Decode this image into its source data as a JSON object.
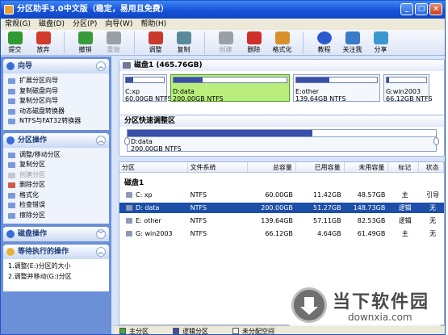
{
  "window": {
    "title": "分区助手3.0中文版（稳定，易用且免费）",
    "minimize": "_",
    "maximize": "□",
    "close": "×"
  },
  "menu": [
    "常规(G)",
    "磁盘(D)",
    "分区(P)",
    "向导(W)",
    "帮助(H)"
  ],
  "toolbar": {
    "items": [
      {
        "label": "提交",
        "icon": "commit-check-icon",
        "color": "#2f9a2f",
        "enabled": true
      },
      {
        "label": "放弃",
        "icon": "discard-x-icon",
        "color": "#d23a2a",
        "enabled": true
      },
      {
        "label": "撤销",
        "icon": "undo-icon",
        "color": "#3a9a3a",
        "enabled": true
      },
      {
        "label": "重做",
        "icon": "redo-icon",
        "color": "#9aa0a8",
        "enabled": false
      },
      {
        "label": "调整",
        "icon": "resize-icon",
        "color": "#c83a2a",
        "enabled": true
      },
      {
        "label": "复制",
        "icon": "copy-icon",
        "color": "#5a8a9a",
        "enabled": true
      },
      {
        "label": "创建",
        "icon": "create-icon",
        "color": "#9aa0a8",
        "enabled": false
      },
      {
        "label": "删除",
        "icon": "delete-icon",
        "color": "#d0302a",
        "enabled": true
      },
      {
        "label": "格式化",
        "icon": "format-icon",
        "color": "#d8902a",
        "enabled": true
      },
      {
        "label": "教程",
        "icon": "help-icon",
        "color": "#2a5ad0",
        "enabled": true
      },
      {
        "label": "关注我",
        "icon": "follow-icon",
        "color": "#3a7ac8",
        "enabled": true
      },
      {
        "label": "分享",
        "icon": "share-icon",
        "color": "#3a9ad0",
        "enabled": true
      }
    ]
  },
  "sidebar": {
    "wizard": {
      "title": "向导",
      "items": [
        "扩展分区向导",
        "复制磁盘向导",
        "复制分区向导",
        "动态磁盘转换器",
        "NTFS与FAT32转换器"
      ]
    },
    "partition_ops": {
      "title": "分区操作",
      "items": [
        {
          "label": "调整/移动分区",
          "enabled": true
        },
        {
          "label": "复制分区",
          "enabled": true
        },
        {
          "label": "创建分区",
          "enabled": false
        },
        {
          "label": "删除分区",
          "enabled": true
        },
        {
          "label": "格式化",
          "enabled": true
        },
        {
          "label": "检查错误",
          "enabled": true
        },
        {
          "label": "擦除分区",
          "enabled": true
        }
      ]
    },
    "disk_ops": {
      "title": "磁盘操作"
    },
    "pending": {
      "title": "等待执行的操作",
      "items": [
        "1.调整(E:)分区的大小",
        "2.调整并移动(G:)分区"
      ]
    }
  },
  "disk": {
    "header": "磁盘1 (465.76GB)",
    "partitions": [
      {
        "name": "C:xp",
        "size": "60.00GB NTFS",
        "used_pct": 0.19,
        "selected": false
      },
      {
        "name": "D:data",
        "size": "200.00GB NTFS",
        "used_pct": 0.26,
        "selected": true
      },
      {
        "name": "E:other",
        "size": "139.64GB NTFS",
        "used_pct": 0.41,
        "selected": false
      },
      {
        "name": "G:win2003",
        "size": "66.12GB NTFS",
        "used_pct": 0.07,
        "selected": false
      }
    ]
  },
  "adjust": {
    "title": "分区快速调整区",
    "name": "D:data",
    "size": "200.00GB NTFS",
    "used_pct": 0.6
  },
  "table": {
    "headers": [
      "分区",
      "文件系统",
      "总容量",
      "已用容量",
      "未用容量",
      "标记",
      "状态"
    ],
    "group": "磁盘1",
    "rows": [
      {
        "name": "C: xp",
        "fs": "NTFS",
        "total": "60.00GB",
        "used": "11.42GB",
        "free": "48.57GB",
        "flag": "主",
        "status": "引导",
        "selected": false
      },
      {
        "name": "D: data",
        "fs": "NTFS",
        "total": "200.00GB",
        "used": "51.27GB",
        "free": "148.73GB",
        "flag": "逻辑",
        "status": "无",
        "selected": true
      },
      {
        "name": "E: other",
        "fs": "NTFS",
        "total": "139.64GB",
        "used": "57.11GB",
        "free": "82.53GB",
        "flag": "逻辑",
        "status": "无",
        "selected": false
      },
      {
        "name": "G: win2003",
        "fs": "NTFS",
        "total": "66.12GB",
        "used": "4.64GB",
        "free": "61.49GB",
        "flag": "主",
        "status": "无",
        "selected": false
      }
    ]
  },
  "legend": [
    {
      "label": "主分区",
      "color": "#3fae3f"
    },
    {
      "label": "逻辑分区",
      "color": "#3a4fa8"
    },
    {
      "label": "未分配空间",
      "color": "#f4f4f4"
    }
  ],
  "watermark": {
    "cn": "当下软件园",
    "en": "downxia.com"
  }
}
